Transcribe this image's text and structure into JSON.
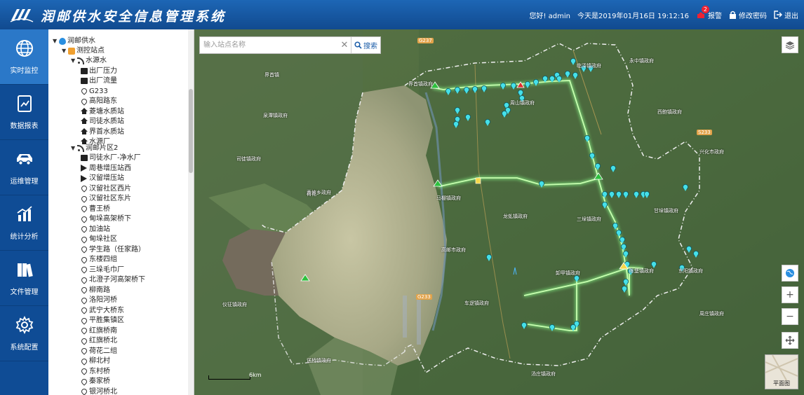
{
  "header": {
    "title": "润邮供水安全信息管理系统",
    "greeting": "您好! admin",
    "date": "今天是2019年01月16日 19:12:16",
    "alarm_label": "报警",
    "alarm_count": "2",
    "change_password": "修改密码",
    "logout": "退出"
  },
  "sidebar": {
    "items": [
      {
        "label": "实时监控",
        "icon": "globe-icon",
        "active": true
      },
      {
        "label": "数据报表",
        "icon": "report-icon"
      },
      {
        "label": "运维管理",
        "icon": "car-icon"
      },
      {
        "label": "统计分析",
        "icon": "chart-icon"
      },
      {
        "label": "文件管理",
        "icon": "folder-icon"
      },
      {
        "label": "系统配置",
        "icon": "gear-icon"
      }
    ]
  },
  "tree": {
    "root": "润邮供水",
    "station": "测控站点",
    "group1": "水源水",
    "group1_items": [
      {
        "label": "出厂压力",
        "icon": "sq"
      },
      {
        "label": "出厂流量",
        "icon": "sq"
      },
      {
        "label": "G233",
        "icon": "pin"
      },
      {
        "label": "高阳路东",
        "icon": "pin"
      },
      {
        "label": "菱塘水质站",
        "icon": "house"
      },
      {
        "label": "司徒水质站",
        "icon": "house"
      },
      {
        "label": "界首水质站",
        "icon": "house"
      },
      {
        "label": "水源厂",
        "icon": "house"
      }
    ],
    "group2": "润邮片区2",
    "group2_items": [
      {
        "label": "司徒水厂-净水厂",
        "icon": "sq"
      },
      {
        "label": "周巷增压站西",
        "icon": "play"
      },
      {
        "label": "汉留增压站",
        "icon": "play"
      },
      {
        "label": "汉留社区西片",
        "icon": "pin"
      },
      {
        "label": "汉留社区东片",
        "icon": "pin"
      },
      {
        "label": "曹王桥",
        "icon": "pin"
      },
      {
        "label": "甸垛高架桥下",
        "icon": "pin"
      },
      {
        "label": "加油站",
        "icon": "pin"
      },
      {
        "label": "甸垛社区",
        "icon": "pin"
      },
      {
        "label": "学生路（任家路）",
        "icon": "pin"
      },
      {
        "label": "东楼四组",
        "icon": "pin"
      },
      {
        "label": "三垛毛巾厂",
        "icon": "pin"
      },
      {
        "label": "北澄子河高架桥下",
        "icon": "pin"
      },
      {
        "label": "柳南路",
        "icon": "pin"
      },
      {
        "label": "洛阳河桥",
        "icon": "pin"
      },
      {
        "label": "武宁大桥东",
        "icon": "pin"
      },
      {
        "label": "平胜集镇区",
        "icon": "pin"
      },
      {
        "label": "红旗桥南",
        "icon": "pin"
      },
      {
        "label": "红旗桥北",
        "icon": "pin"
      },
      {
        "label": "荷花二组",
        "icon": "pin"
      },
      {
        "label": "柳北村",
        "icon": "pin"
      },
      {
        "label": "东村桥",
        "icon": "pin"
      },
      {
        "label": "秦家桥",
        "icon": "pin"
      },
      {
        "label": "银河桥北",
        "icon": "pin"
      },
      {
        "label": "沐家桥北",
        "icon": "pin"
      }
    ]
  },
  "map": {
    "search_placeholder": "输入站点名称",
    "search_button": "搜索",
    "scale_label": "6km",
    "minimap_label": "平面图",
    "labels": [
      "界首镇政府",
      "周山镇政府",
      "临泽镇政府",
      "永中镇政府",
      "西鲍镇政府",
      "兴化市政府",
      "马棚镇政府",
      "龙虬镇政府",
      "三垛镇政府",
      "高邮市政府",
      "甘垛镇政府",
      "卸甲镇政府",
      "车逻镇政府",
      "汤庄镇政府",
      "周庄镇政府",
      "陈堡镇政府",
      "菱塘乡政府",
      "送桥镇政府",
      "泉潭镇政府",
      "仪征镇政府",
      "东阳镇政府",
      "界首镇",
      "荷花",
      "司徒镇政府"
    ],
    "roads": [
      "G237",
      "S233",
      "G233"
    ]
  }
}
